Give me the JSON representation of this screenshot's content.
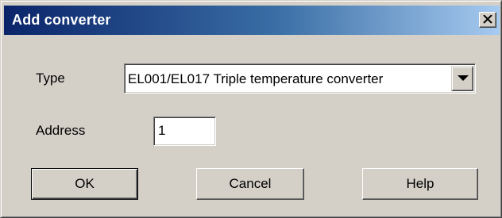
{
  "dialog": {
    "title": "Add converter",
    "close_label": "×"
  },
  "form": {
    "type_label": "Type",
    "type_value": "EL001/EL017 Triple temperature converter",
    "address_label": "Address",
    "address_value": "1"
  },
  "buttons": {
    "ok": "OK",
    "cancel": "Cancel",
    "help": "Help"
  },
  "icons": {
    "close": "close-icon",
    "dropdown": "chevron-down-icon"
  },
  "colors": {
    "titlebar_start": "#0a246a",
    "titlebar_end": "#a6caf0",
    "face": "#d4d0c8"
  }
}
